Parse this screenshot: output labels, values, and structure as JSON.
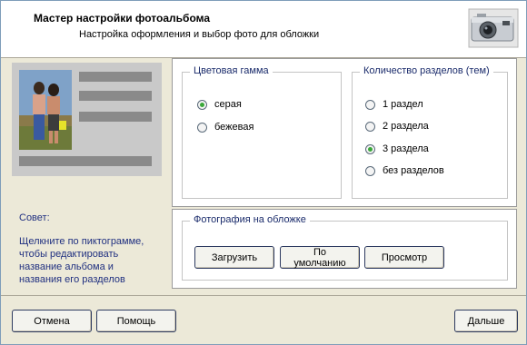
{
  "header": {
    "title": "Мастер настройки фотоальбома",
    "subtitle": "Настройка оформления и выбор фото для обложки"
  },
  "hint": {
    "heading": "Совет:",
    "lines": [
      "Щелкните по пиктограмме,",
      "чтобы редактировать",
      "название альбома и",
      "названия его разделов"
    ]
  },
  "color_scheme": {
    "legend": "Цветовая гамма",
    "options": [
      {
        "label": "серая",
        "selected": true
      },
      {
        "label": "бежевая",
        "selected": false
      }
    ]
  },
  "sections": {
    "legend": "Количество разделов (тем)",
    "options": [
      {
        "label": "1 раздел",
        "selected": false
      },
      {
        "label": "2 раздела",
        "selected": false
      },
      {
        "label": "3 раздела",
        "selected": true
      },
      {
        "label": "без разделов",
        "selected": false
      }
    ]
  },
  "cover_photo": {
    "legend": "Фотография на обложке",
    "upload_label": "Загрузить",
    "default_label": "По умолчанию",
    "view_label": "Просмотр"
  },
  "footer": {
    "cancel_label": "Отмена",
    "help_label": "Помощь",
    "next_label": "Дальше"
  },
  "colors": {
    "accent_text": "#1a2b6b",
    "radio_selected": "#3aa83a",
    "preview_bg": "#c9c9c9"
  }
}
